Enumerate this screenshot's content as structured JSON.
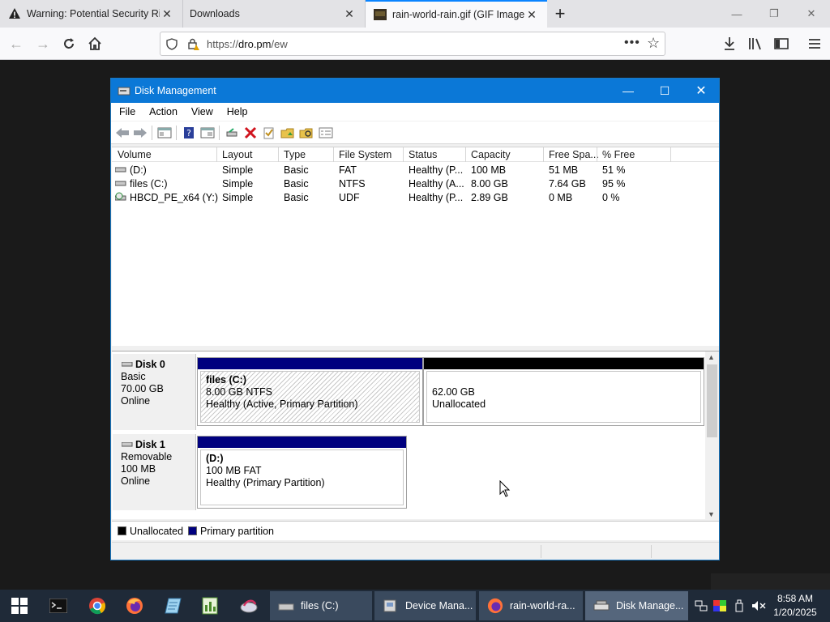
{
  "browser": {
    "tabs": [
      {
        "title": "Warning: Potential Security Ri",
        "active": false
      },
      {
        "title": "Downloads",
        "active": false
      },
      {
        "title": "rain-world-rain.gif (GIF Image",
        "active": true
      }
    ],
    "url_prefix": "https://",
    "url_host": "dro.pm",
    "url_path": "/ew"
  },
  "window": {
    "title": "Disk Management",
    "menu": [
      "File",
      "Action",
      "View",
      "Help"
    ]
  },
  "volume_list": {
    "columns": [
      "Volume",
      "Layout",
      "Type",
      "File System",
      "Status",
      "Capacity",
      "Free Spa...",
      "% Free"
    ],
    "rows": [
      {
        "volume": "(D:)",
        "layout": "Simple",
        "type": "Basic",
        "fs": "FAT",
        "status": "Healthy (P...",
        "capacity": "100 MB",
        "free": "51 MB",
        "pct": "51 %"
      },
      {
        "volume": "files (C:)",
        "layout": "Simple",
        "type": "Basic",
        "fs": "NTFS",
        "status": "Healthy (A...",
        "capacity": "8.00 GB",
        "free": "7.64 GB",
        "pct": "95 %"
      },
      {
        "volume": "HBCD_PE_x64 (Y:)",
        "layout": "Simple",
        "type": "Basic",
        "fs": "UDF",
        "status": "Healthy (P...",
        "capacity": "2.89 GB",
        "free": "0 MB",
        "pct": "0 %"
      }
    ]
  },
  "disks": [
    {
      "name": "Disk 0",
      "kind": "Basic",
      "size": "70.00 GB",
      "state": "Online",
      "partitions": [
        {
          "name": "files  (C:)",
          "detail": "8.00 GB NTFS",
          "status": "Healthy (Active, Primary Partition)"
        },
        {
          "name": "",
          "detail": "62.00 GB",
          "status": "Unallocated"
        }
      ]
    },
    {
      "name": "Disk 1",
      "kind": "Removable",
      "size": "100 MB",
      "state": "Online",
      "partitions": [
        {
          "name": "(D:)",
          "detail": "100 MB FAT",
          "status": "Healthy (Primary Partition)"
        }
      ]
    }
  ],
  "legend": [
    "Unallocated",
    "Primary partition"
  ],
  "colors": {
    "primary": "#00007f",
    "unallocated": "#000000",
    "accent": "#0a84ff",
    "titlebar": "#0b78d7"
  },
  "taskbar": {
    "tasks": [
      "files (C:)",
      "Device Mana...",
      "rain-world-ra...",
      "Disk Manage..."
    ],
    "time": "8:58 AM",
    "date": "1/20/2025"
  }
}
